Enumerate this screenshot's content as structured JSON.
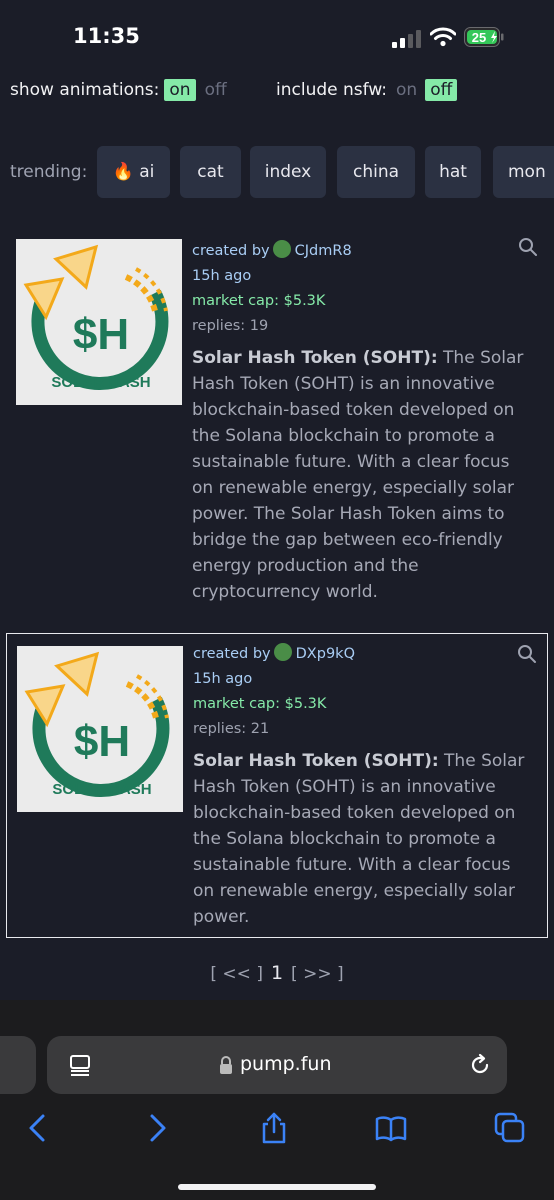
{
  "status": {
    "time": "11:35",
    "battery": "25"
  },
  "toggles": {
    "animations_label": "show animations:",
    "animations_on": "on",
    "animations_off": "off",
    "nsfw_label": "include nsfw:",
    "nsfw_on": "on",
    "nsfw_off": "off"
  },
  "trending": {
    "label": "trending:",
    "chips": [
      "🔥 ai",
      "cat",
      "index",
      "china",
      "hat",
      "mon"
    ]
  },
  "cards": [
    {
      "created_by_label": "created by",
      "creator": "CJdmR8",
      "age": "15h ago",
      "market_cap": "market cap: $5.3K",
      "replies": "replies: 19",
      "name": "Solar Hash Token (SOHT):",
      "description": "The Solar Hash Token (SOHT) is an innovative blockchain-based token developed on the Solana blockchain to promote a sustainable future. With a clear focus on renewable energy, especially solar power. The Solar Hash Token aims to bridge the gap between eco-friendly energy production and the cryptocurrency world."
    },
    {
      "created_by_label": "created by",
      "creator": "DXp9kQ",
      "age": "15h ago",
      "market_cap": "market cap: $5.3K",
      "replies": "replies: 21",
      "name": "Solar Hash Token (SOHT):",
      "description": "The Solar Hash Token (SOHT) is an innovative blockchain-based token developed on the Solana blockchain to promote a sustainable future. With a clear focus on renewable energy, especially solar power."
    }
  ],
  "logo": {
    "mark": "$H",
    "wordmark": "SOLAR HASH"
  },
  "pager": {
    "prev": "[ << ]",
    "current": "1",
    "next": "[ >> ]"
  },
  "browser": {
    "url": "pump.fun"
  },
  "colors": {
    "background": "#1b1d28",
    "accent_green": "#85e9a8",
    "link_blue": "#a9cdf4",
    "safari_blue": "#3b82f6"
  },
  "icons": [
    "signal-icon",
    "wifi-icon",
    "battery-icon",
    "search-icon",
    "reader-icon",
    "lock-icon",
    "reload-icon",
    "back-icon",
    "forward-icon",
    "share-icon",
    "bookmarks-icon",
    "tabs-icon"
  ]
}
